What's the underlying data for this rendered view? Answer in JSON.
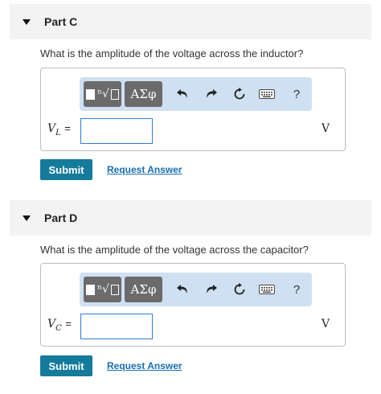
{
  "parts": [
    {
      "title": "Part C",
      "question": "What is the amplitude of the voltage across the inductor?",
      "toolbar": {
        "symbols_label": "ΑΣφ",
        "templates_root": "ⁿ√",
        "help_label": "?"
      },
      "variable": {
        "symbol": "V",
        "subscript": "L",
        "equals": "="
      },
      "input_value": "",
      "unit": "V",
      "submit_label": "Submit",
      "request_label": "Request Answer"
    },
    {
      "title": "Part D",
      "question": "What is the amplitude of the voltage across the capacitor?",
      "toolbar": {
        "symbols_label": "ΑΣφ",
        "templates_root": "ⁿ√",
        "help_label": "?"
      },
      "variable": {
        "symbol": "V",
        "subscript": "C",
        "equals": "="
      },
      "input_value": "",
      "unit": "V",
      "submit_label": "Submit",
      "request_label": "Request Answer"
    }
  ],
  "icons": {
    "collapse": "triangle-down-icon",
    "undo": "undo-icon",
    "redo": "redo-icon",
    "reset": "reset-icon",
    "keyboard": "keyboard-icon"
  }
}
